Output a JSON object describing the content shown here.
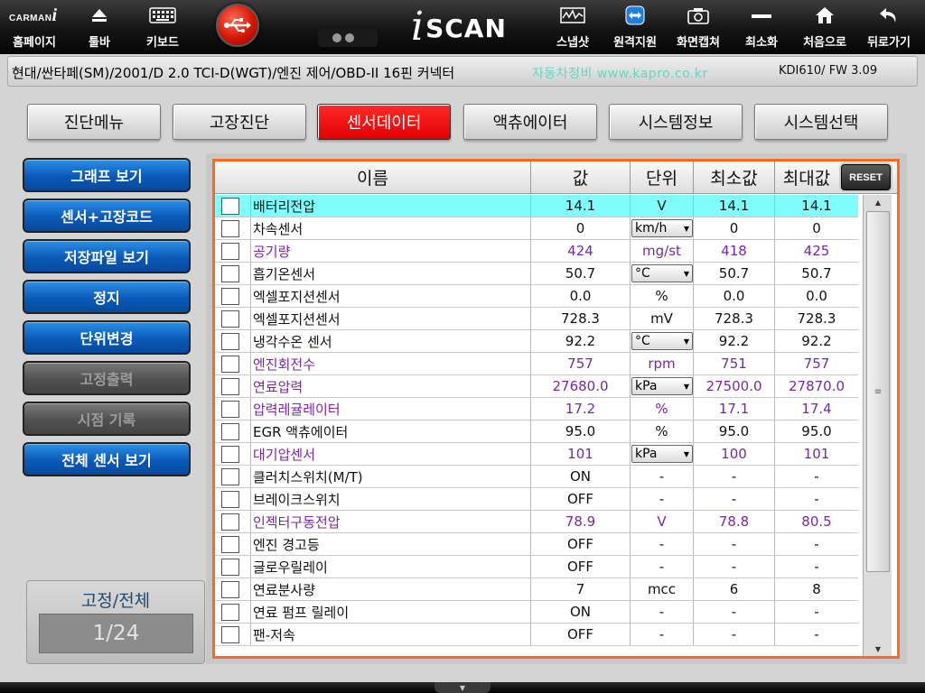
{
  "toolbar": {
    "brand_text": "CARMAN",
    "brand_i": "i",
    "logo_i": "i",
    "logo_text": "SCAN",
    "items": [
      {
        "label": "홈페이지",
        "icon": "brand-logo"
      },
      {
        "label": "툴바",
        "icon": "eject-icon"
      },
      {
        "label": "키보드",
        "icon": "keyboard-icon"
      },
      {
        "label": "스냅샷",
        "icon": "waveform-icon"
      },
      {
        "label": "원격지원",
        "icon": "remote-support-icon"
      },
      {
        "label": "화면캡쳐",
        "icon": "camera-icon"
      },
      {
        "label": "최소화",
        "icon": "minimize-icon"
      },
      {
        "label": "처음으로",
        "icon": "home-icon"
      },
      {
        "label": "뒤로가기",
        "icon": "back-icon"
      }
    ]
  },
  "infobar": {
    "vehicle_path": "현대/싼타페(SM)/2001/D 2.0 TCI-D(WGT)/엔진 제어/OBD-II 16핀 커넥터",
    "company": "자동차정비 www.kapro.co.kr",
    "firmware": "KDI610/ FW 3.09"
  },
  "tabs": [
    {
      "label": "진단메뉴",
      "active": false
    },
    {
      "label": "고장진단",
      "active": false
    },
    {
      "label": "센서데이터",
      "active": true
    },
    {
      "label": "액츄에이터",
      "active": false
    },
    {
      "label": "시스템정보",
      "active": false
    },
    {
      "label": "시스템선택",
      "active": false
    }
  ],
  "sidebar": {
    "buttons": [
      {
        "label": "그래프 보기",
        "enabled": true
      },
      {
        "label": "센서+고장코드",
        "enabled": true
      },
      {
        "label": "저장파일 보기",
        "enabled": true
      },
      {
        "label": "정지",
        "enabled": true
      },
      {
        "label": "단위변경",
        "enabled": true
      },
      {
        "label": "고정출력",
        "enabled": false
      },
      {
        "label": "시점 기록",
        "enabled": false
      },
      {
        "label": "전체 센서 보기",
        "enabled": true
      }
    ],
    "fixed_panel": {
      "title": "고정/전체",
      "count": "1/24"
    }
  },
  "table": {
    "headers": {
      "name": "이름",
      "value": "값",
      "unit": "단위",
      "min": "최소값",
      "max": "최대값"
    },
    "reset_label": "RESET",
    "rows": [
      {
        "name": "배터리전압",
        "value": "14.1",
        "unit": "V",
        "min": "14.1",
        "max": "14.1",
        "color": "black",
        "dropdown": false,
        "highlight": true
      },
      {
        "name": "차속센서",
        "value": "0",
        "unit": "km/h",
        "min": "0",
        "max": "0",
        "color": "black",
        "dropdown": true,
        "highlight": false
      },
      {
        "name": "공기량",
        "value": "424",
        "unit": "mg/st",
        "min": "418",
        "max": "425",
        "color": "purple",
        "dropdown": false,
        "highlight": false
      },
      {
        "name": "흡기온센서",
        "value": "50.7",
        "unit": "°C",
        "min": "50.7",
        "max": "50.7",
        "color": "black",
        "dropdown": true,
        "highlight": false
      },
      {
        "name": "엑셀포지션센서",
        "value": "0.0",
        "unit": "%",
        "min": "0.0",
        "max": "0.0",
        "color": "black",
        "dropdown": false,
        "highlight": false
      },
      {
        "name": "엑셀포지션센서",
        "value": "728.3",
        "unit": "mV",
        "min": "728.3",
        "max": "728.3",
        "color": "black",
        "dropdown": false,
        "highlight": false
      },
      {
        "name": "냉각수온 센서",
        "value": "92.2",
        "unit": "°C",
        "min": "92.2",
        "max": "92.2",
        "color": "black",
        "dropdown": true,
        "highlight": false
      },
      {
        "name": "엔진회전수",
        "value": "757",
        "unit": "rpm",
        "min": "751",
        "max": "757",
        "color": "purple",
        "dropdown": false,
        "highlight": false
      },
      {
        "name": "연료압력",
        "value": "27680.0",
        "unit": "kPa",
        "min": "27500.0",
        "max": "27870.0",
        "color": "purple",
        "dropdown": true,
        "highlight": false
      },
      {
        "name": "압력레귤레이터",
        "value": "17.2",
        "unit": "%",
        "min": "17.1",
        "max": "17.4",
        "color": "purple",
        "dropdown": false,
        "highlight": false
      },
      {
        "name": "EGR 액츄에이터",
        "value": "95.0",
        "unit": "%",
        "min": "95.0",
        "max": "95.0",
        "color": "black",
        "dropdown": false,
        "highlight": false
      },
      {
        "name": "대기압센서",
        "value": "101",
        "unit": "kPa",
        "min": "100",
        "max": "101",
        "color": "purple",
        "dropdown": true,
        "highlight": false
      },
      {
        "name": "클러치스위치(M/T)",
        "value": "ON",
        "unit": "-",
        "min": "-",
        "max": "-",
        "color": "black",
        "dropdown": false,
        "highlight": false
      },
      {
        "name": "브레이크스위치",
        "value": "OFF",
        "unit": "-",
        "min": "-",
        "max": "-",
        "color": "black",
        "dropdown": false,
        "highlight": false
      },
      {
        "name": "인젝터구동전압",
        "value": "78.9",
        "unit": "V",
        "min": "78.8",
        "max": "80.5",
        "color": "purple",
        "dropdown": false,
        "highlight": false
      },
      {
        "name": "엔진 경고등",
        "value": "OFF",
        "unit": "-",
        "min": "-",
        "max": "-",
        "color": "black",
        "dropdown": false,
        "highlight": false
      },
      {
        "name": "글로우릴레이",
        "value": "OFF",
        "unit": "-",
        "min": "-",
        "max": "-",
        "color": "black",
        "dropdown": false,
        "highlight": false
      },
      {
        "name": "연료분사량",
        "value": "7",
        "unit": "mcc",
        "min": "6",
        "max": "8",
        "color": "black",
        "dropdown": false,
        "highlight": false
      },
      {
        "name": "연료 펌프 릴레이",
        "value": "ON",
        "unit": "-",
        "min": "-",
        "max": "-",
        "color": "black",
        "dropdown": false,
        "highlight": false
      },
      {
        "name": "팬-저속",
        "value": "OFF",
        "unit": "-",
        "min": "-",
        "max": "-",
        "color": "black",
        "dropdown": false,
        "highlight": false
      }
    ]
  },
  "colors": {
    "accent": "#ff0000",
    "row_highlight": "#7ffcfc",
    "purple_text": "#7a26a6",
    "frame_orange": "#ff6a1a",
    "company_text": "#5ed8c5"
  }
}
